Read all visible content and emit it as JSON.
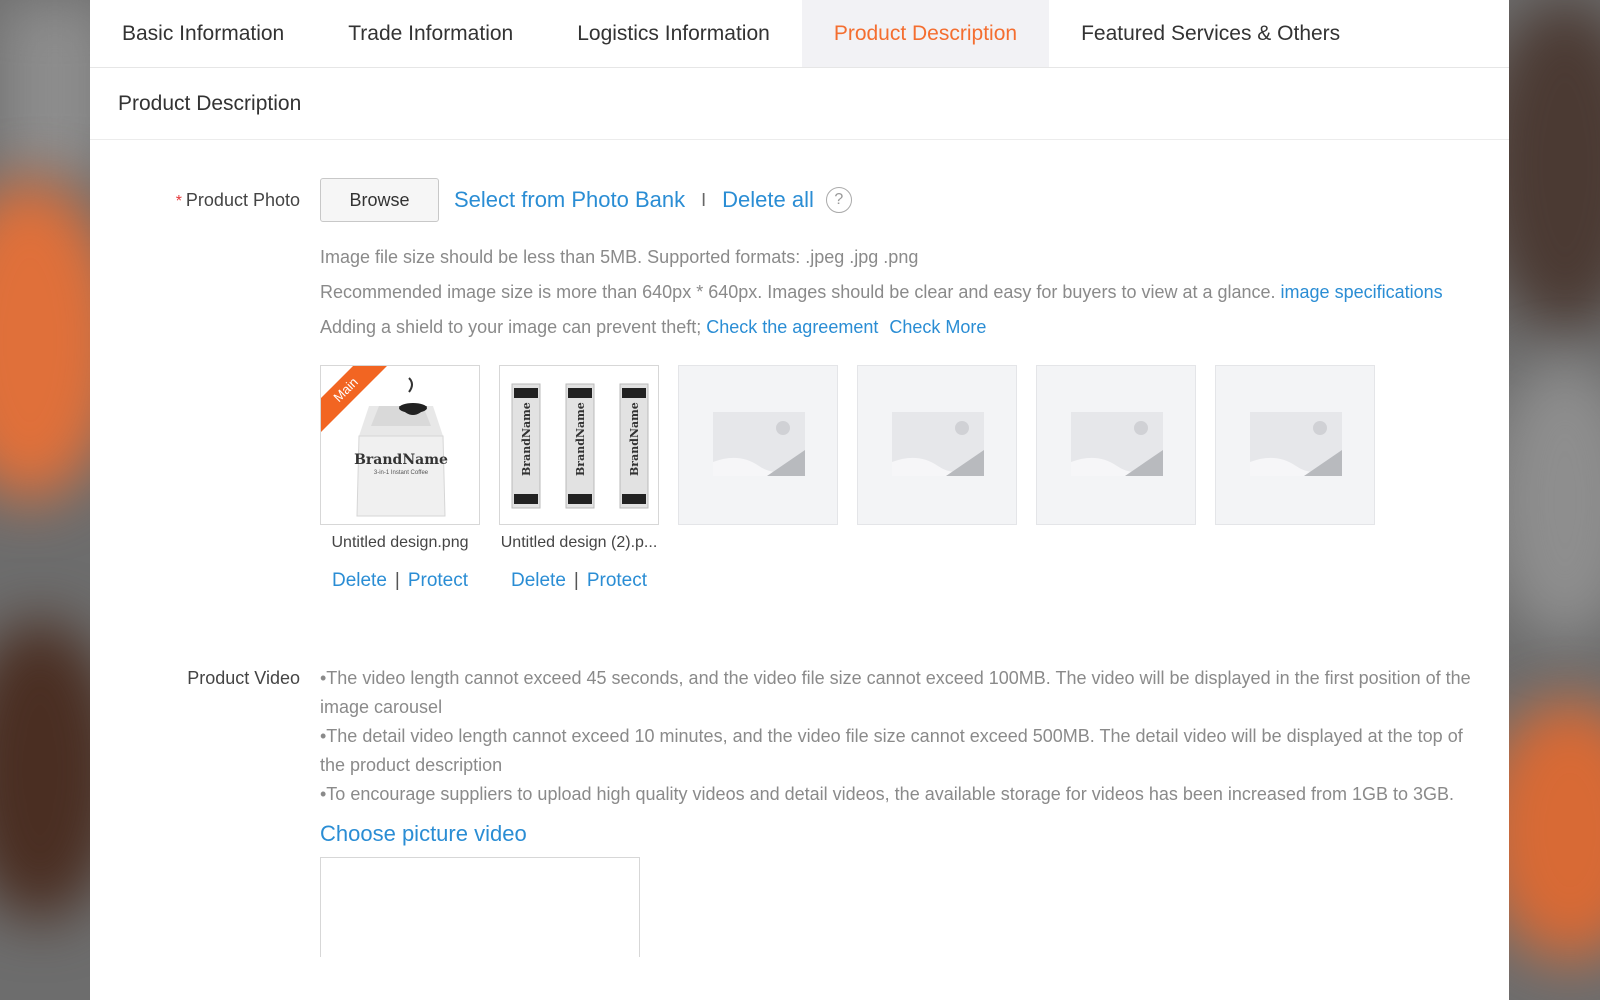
{
  "tabs": [
    {
      "label": "Basic Information"
    },
    {
      "label": "Trade Information"
    },
    {
      "label": "Logistics Information"
    },
    {
      "label": "Product Description"
    },
    {
      "label": "Featured Services & Others"
    }
  ],
  "section_title": "Product Description",
  "photo": {
    "label": "Product Photo",
    "required_mark": "*",
    "browse_label": "Browse",
    "select_bank": "Select from Photo Bank",
    "separator": "I",
    "delete_all": "Delete all",
    "help": "?",
    "hint1": "Image file size should be less than 5MB. Supported formats: .jpeg .jpg .png",
    "hint2": "Recommended image size is more than 640px * 640px. Images should be clear and easy for buyers to view at a glance.",
    "hint2_link": "image specifications",
    "hint3": "Adding a shield to your image can prevent theft;",
    "agreement_link": "Check the agreement",
    "more_link": "Check More",
    "main_badge": "Main",
    "images": [
      {
        "filename": "Untitled design.png",
        "delete": "Delete",
        "bar": "|",
        "protect": "Protect"
      },
      {
        "filename": "Untitled design (2).p...",
        "delete": "Delete",
        "bar": "|",
        "protect": "Protect"
      }
    ],
    "brand_text": "BrandName",
    "brand_sub": "3-in-1 Instant Coffee"
  },
  "video": {
    "label": "Product Video",
    "hint1": "•The video length cannot exceed 45 seconds, and the video file size cannot exceed 100MB. The video will be displayed in the first position of the image carousel",
    "hint2": "•The detail video length cannot exceed 10 minutes, and the video file size cannot exceed 500MB. The detail video will be displayed at the top of the product description",
    "hint3": "•To encourage suppliers to upload high quality videos and detail videos, the available storage for videos has been increased from 1GB to 3GB.",
    "choose_label": "Choose picture video"
  },
  "colors": {
    "accent": "#f46e30",
    "link": "#2a8dd4",
    "required": "#e4393c"
  }
}
